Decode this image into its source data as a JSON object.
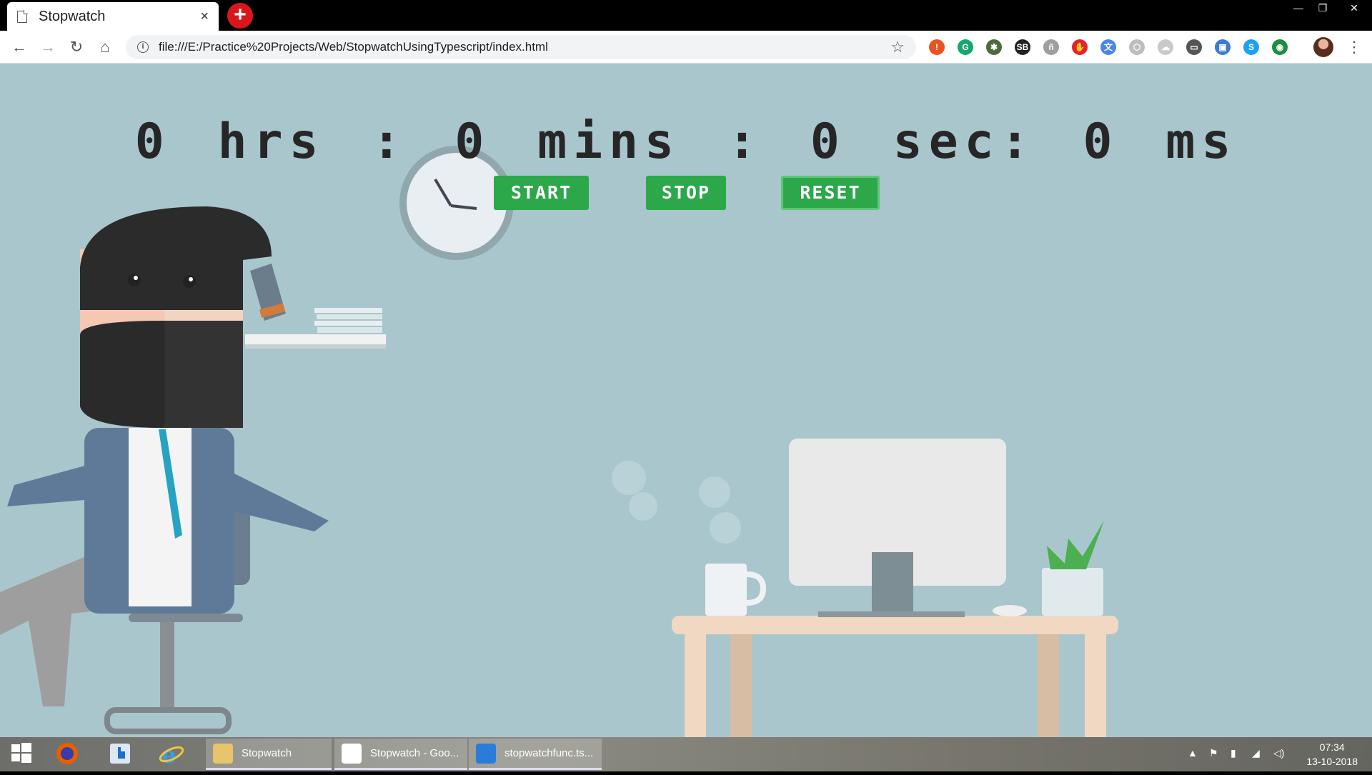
{
  "browser": {
    "tab_title": "Stopwatch",
    "tab_close": "×",
    "new_tab": "+",
    "window_controls": {
      "minimize": "—",
      "maximize": "❐",
      "close": "✕"
    },
    "back": "←",
    "forward": "→",
    "reload": "↻",
    "home": "⌂",
    "url": "file:///E:/Practice%20Projects/Web/StopwatchUsingTypescript/index.html",
    "bookmark": "☆",
    "menu": "⋮",
    "extensions": [
      {
        "name": "alert-extension",
        "color": "#e8541d",
        "glyph": "!"
      },
      {
        "name": "grammarly-extension",
        "color": "#15a86e",
        "glyph": "G"
      },
      {
        "name": "bug-extension",
        "color": "#4c6b3d",
        "glyph": "✱"
      },
      {
        "name": "sb-extension",
        "color": "#222222",
        "glyph": "SB"
      },
      {
        "name": "font-extension",
        "color": "#9e9e9e",
        "glyph": "ñ"
      },
      {
        "name": "adblock-extension",
        "color": "#e3232a",
        "glyph": "✋"
      },
      {
        "name": "translate-extension",
        "color": "#4a86e8",
        "glyph": "文"
      },
      {
        "name": "cube-extension",
        "color": "#bdbdbd",
        "glyph": "⬡"
      },
      {
        "name": "cloud-extension",
        "color": "#c9c9c9",
        "glyph": "☁"
      },
      {
        "name": "cast-extension",
        "color": "#555555",
        "glyph": "▭"
      },
      {
        "name": "screen-extension",
        "color": "#3a7bd5",
        "glyph": "▣"
      },
      {
        "name": "skype-extension",
        "color": "#1da1f2",
        "glyph": "S"
      },
      {
        "name": "globe-extension",
        "color": "#1e8e3e",
        "glyph": "◉"
      }
    ]
  },
  "stopwatch": {
    "hours_value": "0",
    "hours_unit": "hrs",
    "sep1": ":",
    "minutes_value": "0",
    "minutes_unit": "mins",
    "sep2": ":",
    "seconds_value": "0",
    "seconds_unit": "sec:",
    "ms_value": "0",
    "ms_unit": "ms",
    "start_label": "START",
    "stop_label": "STOP",
    "reset_label": "RESET"
  },
  "taskbar": {
    "tasks": [
      {
        "label": "Stopwatch",
        "color": "#e8c46a"
      },
      {
        "label": "Stopwatch - Goo...",
        "color": "#ffffff"
      },
      {
        "label": "stopwatchfunc.ts...",
        "color": "#2b7bd9"
      }
    ],
    "time": "07:34",
    "date": "13-10-2018"
  }
}
